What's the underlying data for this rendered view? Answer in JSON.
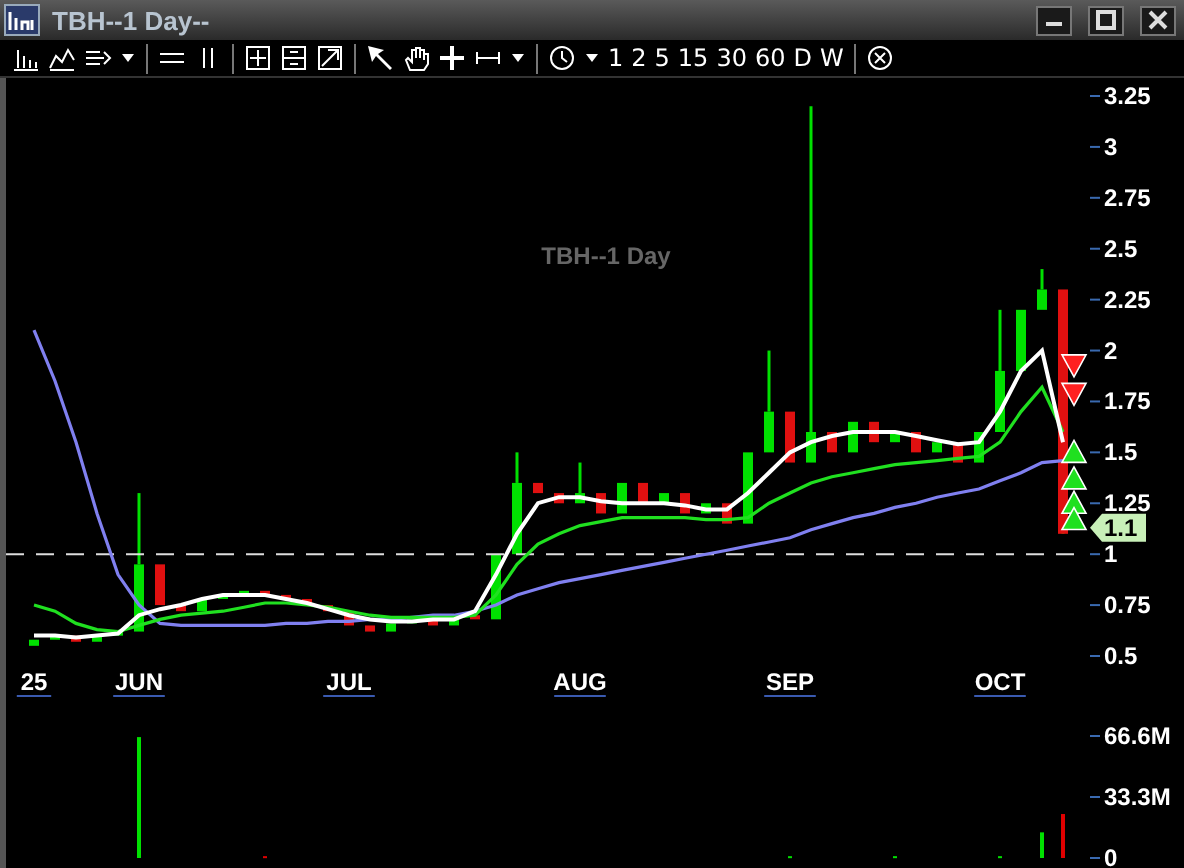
{
  "window": {
    "title": "TBH--1 Day--"
  },
  "toolbar": {
    "timeframes": [
      "1",
      "2",
      "5",
      "15",
      "30",
      "60",
      "D",
      "W"
    ]
  },
  "price_chart": {
    "chart_data": {
      "type": "line",
      "title": "TBH--1 Day",
      "categories": [
        "25",
        null,
        null,
        null,
        null,
        "JUN",
        null,
        null,
        null,
        null,
        null,
        null,
        null,
        null,
        null,
        "JUL",
        null,
        null,
        null,
        null,
        null,
        null,
        null,
        null,
        null,
        null,
        "AUG",
        null,
        null,
        null,
        null,
        null,
        null,
        null,
        null,
        null,
        "SEP",
        null,
        null,
        null,
        null,
        null,
        null,
        null,
        null,
        null,
        "OCT",
        null,
        null,
        null
      ],
      "ylim": [
        0.5,
        3.25
      ],
      "yticks": [
        {
          "value": 3.25,
          "label": "3.25"
        },
        {
          "value": 3,
          "label": "3"
        },
        {
          "value": 2.75,
          "label": "2.75"
        },
        {
          "value": 2.5,
          "label": "2.5"
        },
        {
          "value": 2.25,
          "label": "2.25"
        },
        {
          "value": 2,
          "label": "2"
        },
        {
          "value": 1.75,
          "label": "1.75"
        },
        {
          "value": 1.5,
          "label": "1.5"
        },
        {
          "value": 1.25,
          "label": "1.25"
        },
        {
          "value": 1,
          "label": "1"
        },
        {
          "value": 0.75,
          "label": "0.75"
        },
        {
          "value": 0.5,
          "label": "0.5"
        }
      ],
      "series": [
        {
          "color": "#8080f0",
          "values": [
            2.1,
            1.85,
            1.55,
            1.2,
            0.9,
            0.75,
            0.66,
            0.65,
            0.65,
            0.65,
            0.65,
            0.65,
            0.66,
            0.66,
            0.67,
            0.67,
            0.68,
            0.68,
            0.69,
            0.7,
            0.7,
            0.72,
            0.75,
            0.8,
            0.83,
            0.86,
            0.88,
            0.9,
            0.92,
            0.94,
            0.96,
            0.98,
            1.0,
            1.02,
            1.04,
            1.06,
            1.08,
            1.12,
            1.15,
            1.18,
            1.2,
            1.23,
            1.25,
            1.28,
            1.3,
            1.32,
            1.36,
            1.4,
            1.45,
            1.46
          ]
        },
        {
          "color": "#20e020",
          "values": [
            0.75,
            0.72,
            0.66,
            0.63,
            0.62,
            0.65,
            0.68,
            0.7,
            0.71,
            0.72,
            0.74,
            0.76,
            0.76,
            0.75,
            0.74,
            0.72,
            0.7,
            0.69,
            0.69,
            0.69,
            0.69,
            0.7,
            0.8,
            0.95,
            1.05,
            1.1,
            1.14,
            1.16,
            1.18,
            1.18,
            1.18,
            1.18,
            1.17,
            1.17,
            1.18,
            1.25,
            1.3,
            1.35,
            1.38,
            1.4,
            1.42,
            1.44,
            1.45,
            1.46,
            1.47,
            1.48,
            1.55,
            1.7,
            1.82,
            1.6
          ]
        },
        {
          "color": "#ffffff",
          "values": [
            0.6,
            0.6,
            0.59,
            0.6,
            0.61,
            0.7,
            0.73,
            0.75,
            0.78,
            0.8,
            0.8,
            0.8,
            0.78,
            0.76,
            0.73,
            0.7,
            0.68,
            0.67,
            0.67,
            0.68,
            0.68,
            0.72,
            0.9,
            1.1,
            1.25,
            1.28,
            1.28,
            1.26,
            1.25,
            1.25,
            1.25,
            1.24,
            1.22,
            1.22,
            1.3,
            1.4,
            1.5,
            1.55,
            1.58,
            1.6,
            1.6,
            1.6,
            1.58,
            1.56,
            1.54,
            1.55,
            1.7,
            1.9,
            2.0,
            1.55
          ]
        }
      ],
      "ref_lines": [
        {
          "axis": "y",
          "value": 1
        }
      ]
    },
    "last_price": "1.1",
    "signals": [
      {
        "kind": "down"
      },
      {
        "kind": "down"
      },
      {
        "kind": "up"
      },
      {
        "kind": "up"
      },
      {
        "kind": "up"
      },
      {
        "kind": "up"
      }
    ]
  },
  "volume_chart": {
    "chart_data": {
      "type": "bar",
      "ylim": [
        0,
        66.6
      ],
      "yticks": [
        {
          "value": 66.6,
          "label": "66.6M"
        },
        {
          "value": 33.3,
          "label": "33.3M"
        },
        {
          "value": 0,
          "label": "0"
        }
      ],
      "series": [
        {
          "color": "#00e000",
          "values": [
            0,
            0,
            0,
            0,
            0,
            66,
            0,
            0,
            0,
            0,
            0,
            0,
            0,
            0,
            0,
            0,
            0,
            0,
            0,
            0,
            0,
            0,
            0,
            0,
            0,
            0,
            0,
            0,
            0,
            0,
            0,
            0,
            0,
            0,
            0,
            0,
            1,
            0,
            0,
            0,
            0,
            1,
            0,
            0,
            0,
            0,
            1,
            0,
            14,
            0
          ]
        },
        {
          "color": "#e00000",
          "values": [
            0,
            0,
            0,
            0,
            0,
            0,
            0,
            0,
            0,
            0,
            0,
            1,
            0,
            0,
            0,
            0,
            0,
            0,
            0,
            0,
            0,
            0,
            0,
            0,
            0,
            0,
            0,
            0,
            0,
            0,
            0,
            0,
            0,
            0,
            0,
            0,
            0,
            0,
            0,
            0,
            0,
            0,
            0,
            0,
            0,
            0,
            0,
            0,
            0,
            24
          ]
        }
      ]
    }
  }
}
